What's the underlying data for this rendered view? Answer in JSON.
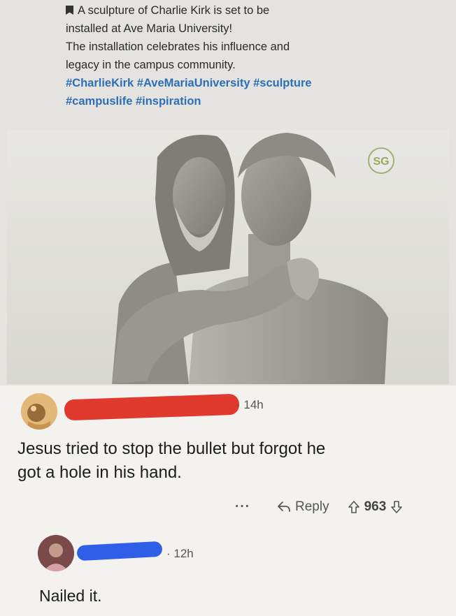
{
  "post": {
    "caption_lines": [
      "A sculpture of Charlie Kirk is set to be",
      "installed at Ave Maria University!",
      "The installation celebrates his influence and",
      "legacy in the campus community."
    ],
    "hashtags": [
      "#CharlieKirk #AveMariaUniversity #sculpture",
      "#campuslife #inspiration"
    ],
    "watermark": "SG"
  },
  "comments": [
    {
      "time": "· 14h",
      "text_lines": [
        "Jesus tried to stop the bullet but forgot he",
        "got a hole in his hand."
      ],
      "more": "···",
      "reply_label": "Reply",
      "score": "963"
    },
    {
      "time": "· 12h",
      "text": "Nailed it."
    }
  ],
  "colors": {
    "hashtag": "#2d6fb6",
    "redaction_red": "#e03a2f",
    "redaction_blue": "#2e5fe6"
  }
}
